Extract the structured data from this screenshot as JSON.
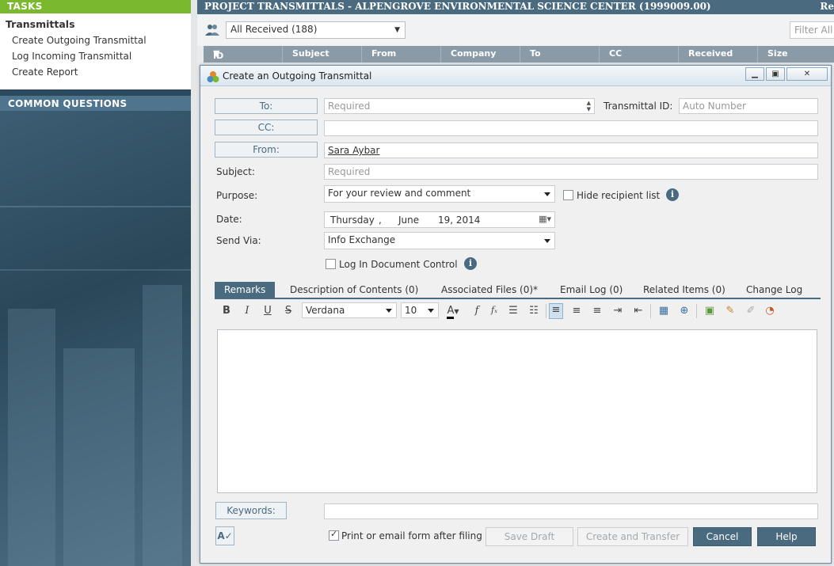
{
  "sidebar": {
    "tasks_header": "TASKS",
    "section_title": "Transmittals",
    "links": [
      "Create Outgoing Transmittal",
      "Log Incoming Transmittal",
      "Create Report"
    ],
    "questions_header": "COMMON QUESTIONS"
  },
  "header": {
    "project_title": "PROJECT TRANSMITTALS - ALPENGROVE ENVIRONMENTAL SCIENCE CENTER (1999009.00)",
    "right_cut": "Re"
  },
  "filter": {
    "view_selected": "All Received (188)",
    "filter_placeholder": "Filter All C"
  },
  "grid": {
    "columns": [
      "ID",
      "Subject",
      "From",
      "Company",
      "To",
      "CC",
      "Received",
      "Size"
    ]
  },
  "dialog": {
    "title": "Create an Outgoing Transmittal",
    "to_label": "To:",
    "to_placeholder": "Required",
    "transmittal_id_label": "Transmittal ID:",
    "transmittal_id_placeholder": "Auto Number",
    "cc_label": "CC:",
    "cc_value": "",
    "from_label": "From:",
    "from_value": "Sara Aybar",
    "subject_label": "Subject:",
    "subject_placeholder": "Required",
    "purpose_label": "Purpose:",
    "purpose_value": "For your review and comment",
    "hide_recipient_label": "Hide recipient list",
    "date_label": "Date:",
    "date_day": "Thursday",
    "date_sep": ",",
    "date_month": "June",
    "date_rest": "19, 2014",
    "send_via_label": "Send Via:",
    "send_via_value": "Info Exchange",
    "log_doc_control_label": "Log In Document Control",
    "tabs": [
      "Remarks",
      "Description of Contents (0)",
      "Associated Files (0)*",
      "Email Log (0)",
      "Related Items (0)",
      "Change Log"
    ],
    "toolbar": {
      "font": "Verdana",
      "size": "10"
    },
    "keywords_label": "Keywords:",
    "keywords_value": "",
    "print_email_label": "Print or email form after filing",
    "print_email_checked": true,
    "buttons": {
      "save_draft": "Save Draft",
      "create_transfer": "Create and Transfer",
      "cancel": "Cancel",
      "help": "Help"
    }
  },
  "colors": {
    "accent_green": "#7ab82e",
    "header_blue": "#4a6a80",
    "dialog_bg": "#f0f0f0"
  }
}
